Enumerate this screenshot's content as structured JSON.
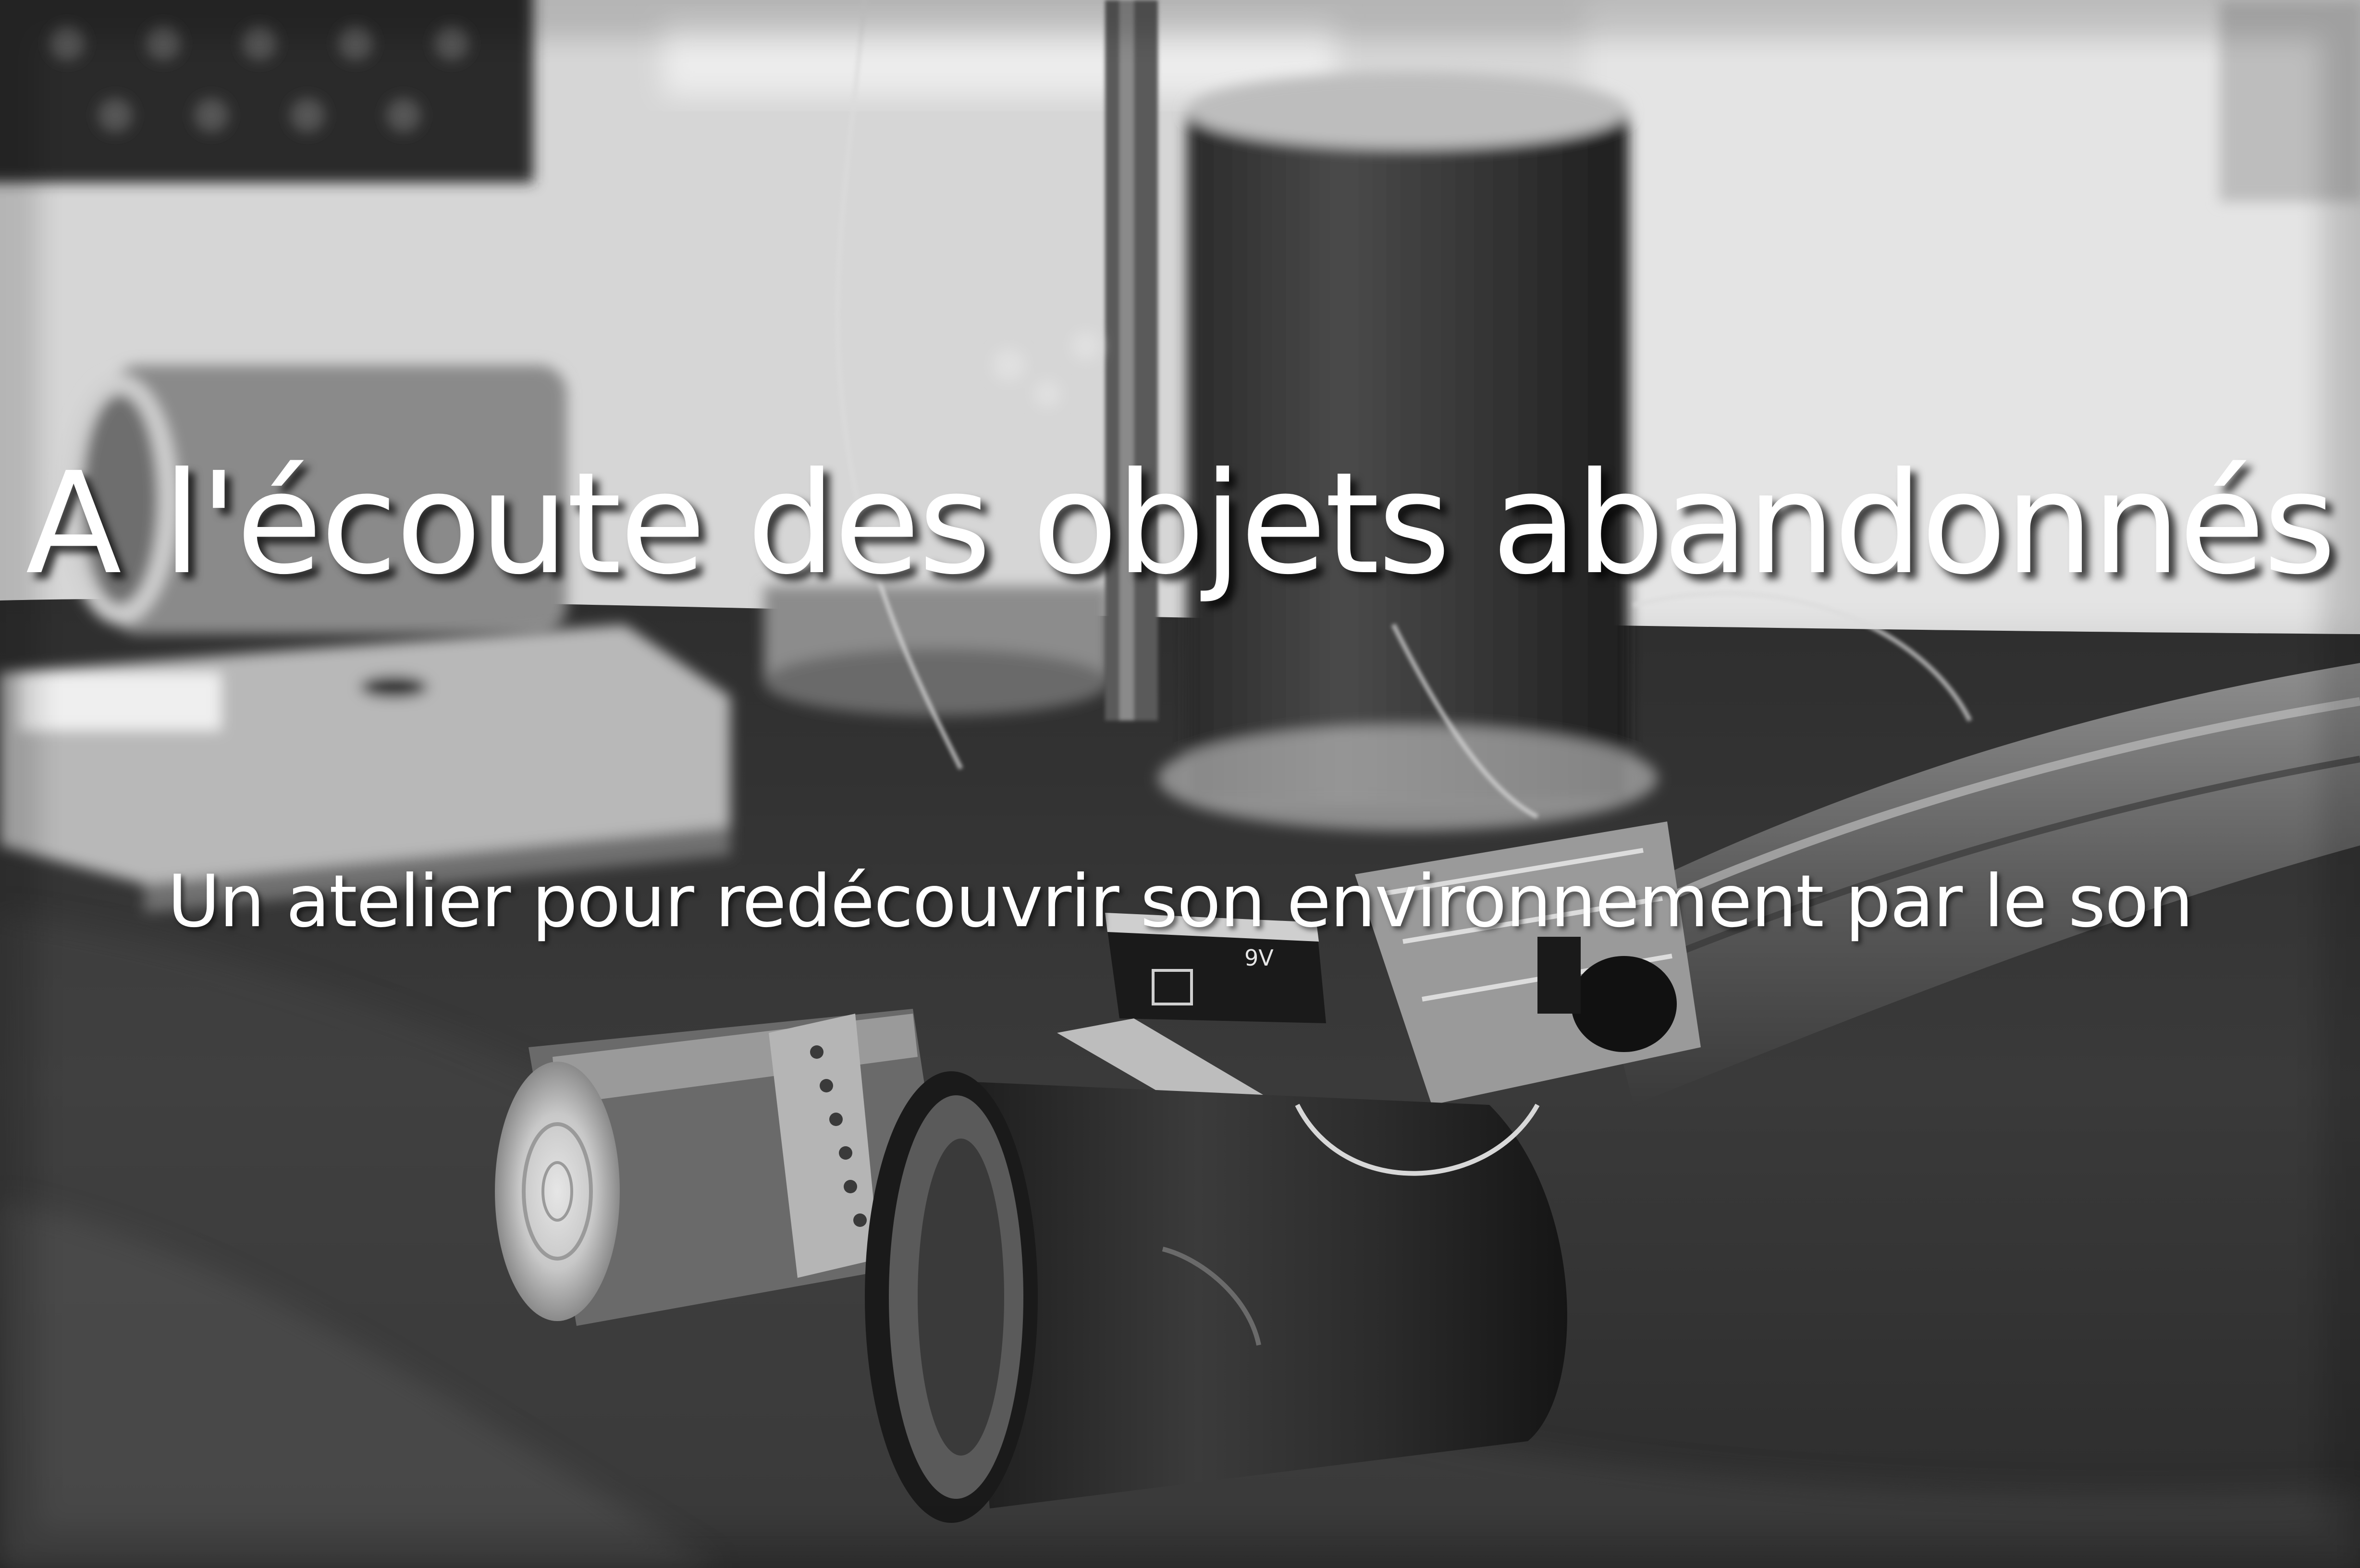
{
  "hero": {
    "title": "A l'écoute des objets abandonnés",
    "subtitle": "Un atelier pour redécouvrir son environnement par le son"
  },
  "photo": {
    "style": "black-and-white",
    "subject": "found-object sound instruments on a dark cloth",
    "battery_label": "9V"
  }
}
